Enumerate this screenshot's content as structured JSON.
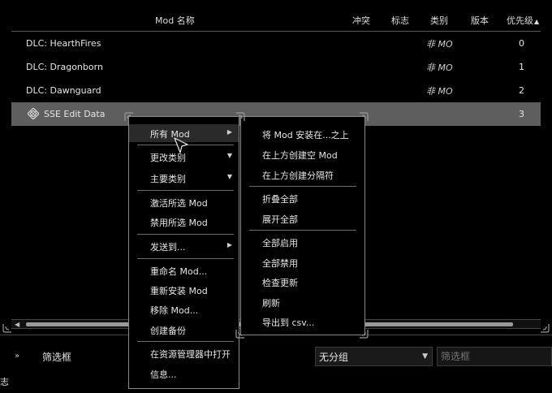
{
  "columns": {
    "name": "Mod 名称",
    "conflicts": "冲突",
    "flags": "标志",
    "category": "类别",
    "version": "版本",
    "priority": "优先级"
  },
  "mods": [
    {
      "name": "DLC: HearthFires",
      "category": "非 MO",
      "priority": "0"
    },
    {
      "name": "DLC: Dragonborn",
      "category": "非 MO",
      "priority": "1"
    },
    {
      "name": "DLC: Dawnguard",
      "category": "非 MO",
      "priority": "2"
    },
    {
      "name": "SSE Edit Data",
      "category": "",
      "priority": "3"
    }
  ],
  "context_menu": {
    "items": [
      {
        "label": "所有 Mod",
        "submenu": true
      },
      {
        "label": "更改类别",
        "submenu": true
      },
      {
        "label": "主要类别",
        "submenu": true
      },
      {
        "label": "激活所选 Mod"
      },
      {
        "label": "禁用所选 Mod"
      },
      {
        "label": "发送到...",
        "submenu": true
      },
      {
        "label": "重命名 Mod..."
      },
      {
        "label": "重新安装 Mod"
      },
      {
        "label": "移除 Mod..."
      },
      {
        "label": "创建备份"
      },
      {
        "label": "在资源管理器中打开"
      },
      {
        "label": "信息..."
      }
    ]
  },
  "submenu": {
    "items": [
      {
        "label": "将 Mod 安装在...之上"
      },
      {
        "label": "在上方创建空 Mod"
      },
      {
        "label": "在上方创建分隔符"
      },
      {
        "label": "折叠全部"
      },
      {
        "label": "展开全部"
      },
      {
        "label": "全部启用"
      },
      {
        "label": "全部禁用"
      },
      {
        "label": "检查更新"
      },
      {
        "label": "刷新"
      },
      {
        "label": "导出到 csv..."
      }
    ]
  },
  "bottom": {
    "filter_label": "筛选框",
    "group_value": "无分组",
    "filter_placeholder": "筛选框",
    "log_label": "志"
  },
  "colors": {
    "background": "#000000",
    "selected_row": "#5e5e5e",
    "menu_border": "#8a8a8a"
  }
}
